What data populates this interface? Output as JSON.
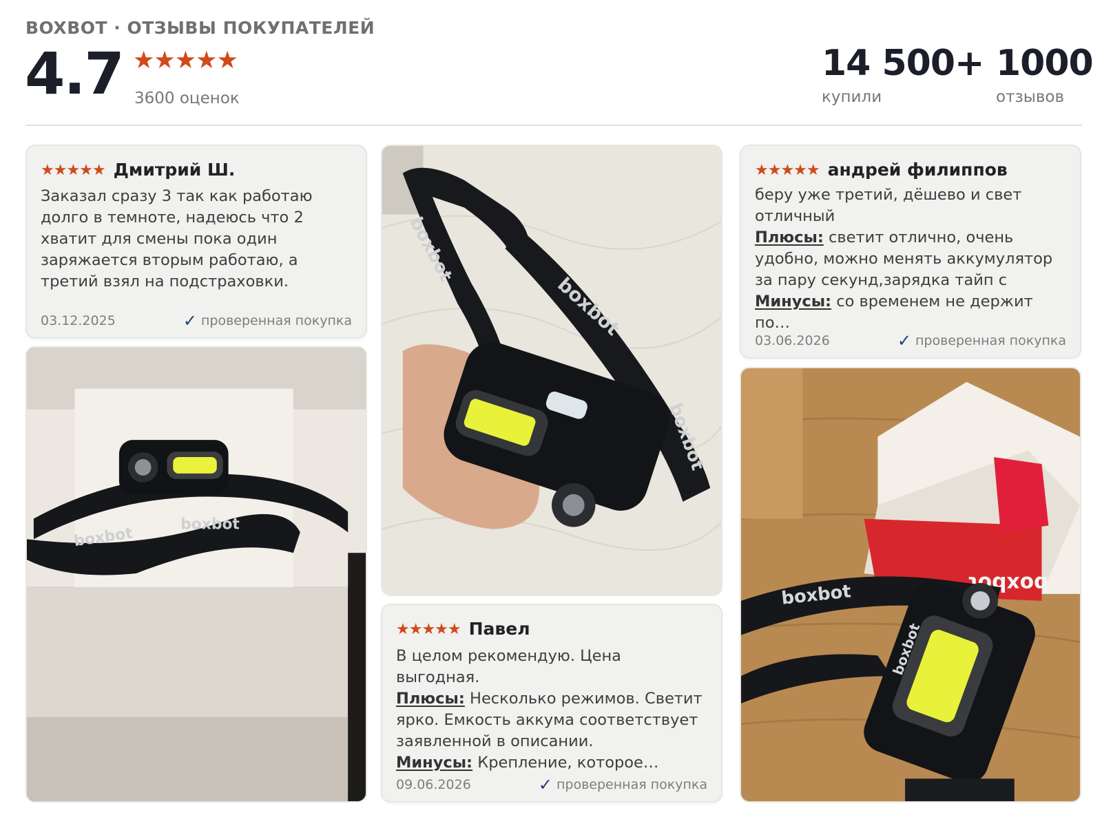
{
  "header": {
    "title": "BOXBOT · ОТЗЫВЫ ПОКУПАТЕЛЕЙ",
    "rating": "4.7",
    "stars": "★★★★★",
    "ratings_count": "3600 оценок",
    "bought_value": "14 500+",
    "bought_label": "купили",
    "reviews_value": "1000",
    "reviews_label": "отзывов"
  },
  "reviews": [
    {
      "stars": "★★★★★",
      "author": "Дмитрий Ш.",
      "text": "Заказал сразу 3 так как работаю долго в темноте, надеюсь что 2 хватит для смены пока один заряжается вторым работаю, а третий взял на подстраховки.",
      "date": "03.12.2025",
      "verified": "проверенная покупка"
    },
    {
      "stars": "★★★★★",
      "author": "андрей филиппов",
      "text": "беру уже третий, дёшево и свет отличный",
      "pros_label": "Плюсы:",
      "pros": " светит отлично, очень удобно, можно менять аккумулятор за пару секунд,зарядка тайп с",
      "cons_label": "Минусы:",
      "cons": " со временем не держит по…",
      "date": "03.06.2026",
      "verified": "проверенная покупка"
    },
    {
      "stars": "★★★★★",
      "author": "Павел",
      "text": "В целом рекомендую. Цена выгодная.",
      "pros_label": "Плюсы:",
      "pros": " Несколько режимов. Светит ярко. Емкость аккума соответствует заявленной в описании.",
      "cons_label": "Минусы:",
      "cons": " Крепление, которое…",
      "date": "09.06.2026",
      "verified": "проверенная покупка"
    }
  ],
  "photos": {
    "brand_mark": "boxbot",
    "colors": {
      "headband": "#17181b",
      "cob_led": "#e8f23a",
      "box_red": "#d8262d",
      "wood": "#b88a52",
      "quilt": "#e9e6de"
    }
  }
}
